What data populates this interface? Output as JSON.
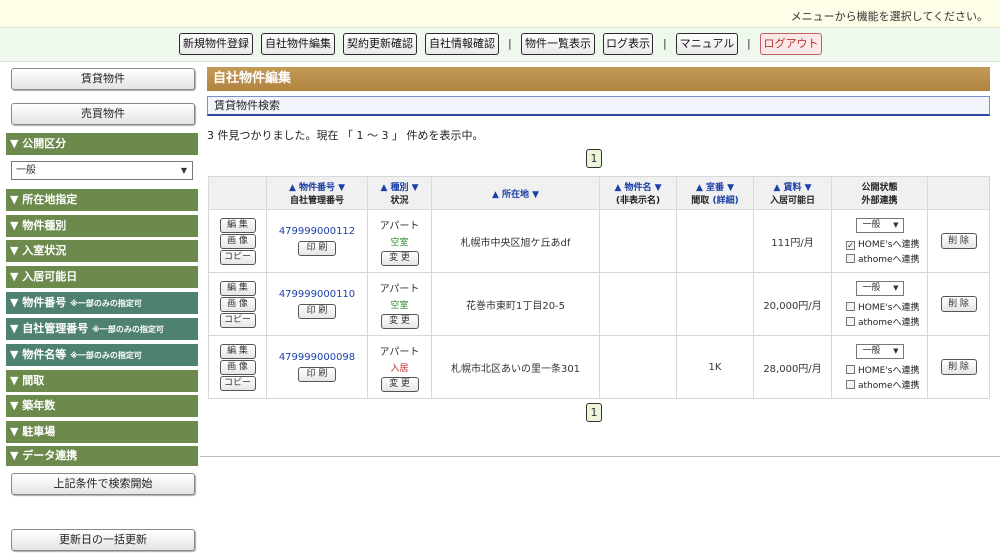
{
  "topbar": {
    "message": "メニューから機能を選択してください。"
  },
  "menu": {
    "items": [
      "新規物件登録",
      "自社物件編集",
      "契約更新確認",
      "自社情報確認",
      "物件一覧表示",
      "ログ表示",
      "マニュアル",
      "ログアウト"
    ],
    "separator": "|"
  },
  "sidebar": {
    "rent_button": "賃貸物件",
    "sale_button": "売買物件",
    "publish_section": "▼ 公開区分",
    "publish_select": "一般",
    "sections": [
      "▼ 所在地指定",
      "▼ 物件種別",
      "▼ 入室状況",
      "▼ 入居可能日"
    ],
    "teal_sections": [
      {
        "label": "▼ 物件番号",
        "note": "※一部のみの指定可"
      },
      {
        "label": "▼ 自社管理番号",
        "note": "※一部のみの指定可"
      },
      {
        "label": "▼ 物件名等",
        "note": "※一部のみの指定可"
      }
    ],
    "sections2": [
      "▼ 間取",
      "▼ 築年数",
      "▼ 駐車場",
      "▼ データ連携"
    ],
    "search_button": "上記条件で検索開始",
    "bulk_update_button": "更新日の一括更新"
  },
  "main": {
    "title": "自社物件編集",
    "subtitle": "賃貸物件検索",
    "result_text": "3 件見つかりました。現在 「 1 ～ 3 」 件めを表示中。",
    "page": "1"
  },
  "table": {
    "headers": {
      "number_top": "▲ 物件番号 ▼",
      "number_bottom": "自社管理番号",
      "type_top": "▲ 種別 ▼",
      "type_bottom": "状況",
      "address": "▲ 所在地 ▼",
      "name_top": "▲ 物件名 ▼",
      "name_bottom": "(非表示名)",
      "room_top": "▲ 室番 ▼",
      "room_bottom_a": "間取",
      "room_bottom_b": "(詳細)",
      "rent_top": "▲ 賃料 ▼",
      "rent_bottom": "入居可能日",
      "publish_top": "公開状態",
      "publish_bottom": "外部連携"
    },
    "buttons": {
      "edit": "編 集",
      "image": "画 像",
      "copy": "コピー",
      "print": "印 刷",
      "change": "変 更",
      "delete": "削 除"
    },
    "rows": [
      {
        "number": "479999000112",
        "type": "アパート",
        "status": "空室",
        "address": "札幌市中央区旭ケ丘あdf",
        "name": "",
        "room": "",
        "rent": "111円/月",
        "publish": "一般",
        "homes": "HOME'sへ連携",
        "athome": "athomeへ連携",
        "homes_checked": "✓"
      },
      {
        "number": "479999000110",
        "type": "アパート",
        "status": "空室",
        "address": "花巻市東町1丁目20-5",
        "name": "",
        "room": "",
        "rent": "20,000円/月",
        "publish": "一般",
        "homes": "HOME'sへ連携",
        "athome": "athomeへ連携",
        "homes_checked": ""
      },
      {
        "number": "479999000098",
        "type": "アパート",
        "status": "入居",
        "address": "札幌市北区あいの里一条301",
        "name": "",
        "room": "1K",
        "rent": "28,000円/月",
        "publish": "一般",
        "homes": "HOME'sへ連携",
        "athome": "athomeへ連携",
        "homes_checked": ""
      }
    ]
  }
}
